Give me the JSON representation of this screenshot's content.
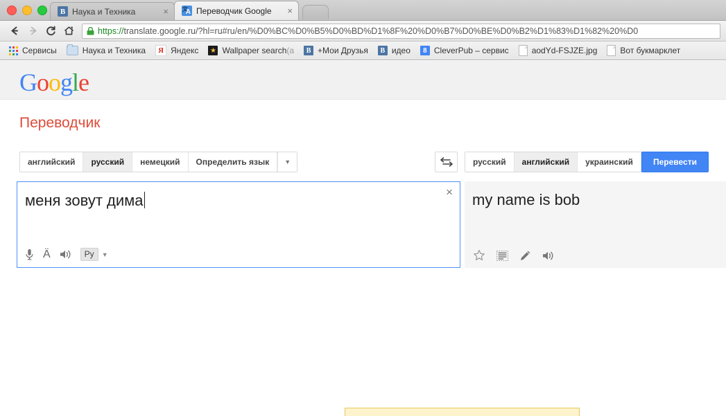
{
  "window": {
    "traffic_lights": [
      "close",
      "minimize",
      "maximize"
    ],
    "tabs": [
      {
        "title": "Наука и Техника",
        "favicon": "vk-icon",
        "active": false,
        "close_label": "×"
      },
      {
        "title": "Переводчик Google",
        "favicon": "google-translate-icon",
        "active": true,
        "close_label": "×"
      }
    ]
  },
  "toolbar": {
    "back_label": "←",
    "forward_label": "→",
    "reload_label": "C",
    "home_label": "⌂",
    "url_scheme": "https://",
    "url_rest": "translate.google.ru/?hl=ru#ru/en/%D0%BC%D0%B5%D0%BD%D1%8F%20%D0%B7%D0%BE%D0%B2%D1%83%D1%82%20%D0",
    "lock_icon": "lock-icon"
  },
  "bookmarks": [
    {
      "label": "Сервисы",
      "icon": "apps-grid-icon",
      "dim": ""
    },
    {
      "label": "Наука и Техника",
      "icon": "folder-icon",
      "dim": ""
    },
    {
      "label": "Яндекс",
      "icon": "yandex-icon",
      "dim": ""
    },
    {
      "label": "Wallpaper search ",
      "icon": "star-black-icon",
      "dim": "(a"
    },
    {
      "label": "+Мои Друзья",
      "icon": "vk-icon",
      "dim": ""
    },
    {
      "label": "идео",
      "icon": "vk-icon",
      "dim": ""
    },
    {
      "label": "CleverPub – сервис",
      "icon": "google-blue-icon",
      "dim": ""
    },
    {
      "label": "aodYd-FSJZE.jpg",
      "icon": "document-icon",
      "dim": ""
    },
    {
      "label": "Вот букмарклет",
      "icon": "document-icon",
      "dim": ""
    }
  ],
  "page": {
    "logo": [
      {
        "ch": "G",
        "color": "blue"
      },
      {
        "ch": "o",
        "color": "red"
      },
      {
        "ch": "o",
        "color": "yellow"
      },
      {
        "ch": "g",
        "color": "blue"
      },
      {
        "ch": "l",
        "color": "green"
      },
      {
        "ch": "e",
        "color": "red"
      }
    ],
    "title": "Переводчик",
    "title_color": "#dd4b39"
  },
  "translate": {
    "source_languages": [
      {
        "label": "английский",
        "active": false
      },
      {
        "label": "русский",
        "active": true
      },
      {
        "label": "немецкий",
        "active": false
      },
      {
        "label": "Определить язык",
        "active": false
      }
    ],
    "source_more_caret": "▼",
    "swap_icon": "swap-arrows-icon",
    "target_languages": [
      {
        "label": "русский",
        "active": false
      },
      {
        "label": "английский",
        "active": true
      },
      {
        "label": "украинский",
        "active": false
      }
    ],
    "target_more_caret": "▼",
    "translate_button": "Перевести",
    "source_text": "меня зовут дима",
    "clear_label": "×",
    "source_tools": [
      {
        "icon": "microphone-icon",
        "label": ""
      },
      {
        "icon": "diacritics-icon",
        "label": "Ä"
      },
      {
        "icon": "speaker-icon",
        "label": ""
      },
      {
        "icon": "keyboard-language-icon",
        "label": "Ру"
      }
    ],
    "keyboard_caret": "▼",
    "result_text": "my name is bob",
    "result_tools": [
      {
        "icon": "star-outline-icon"
      },
      {
        "icon": "text-lines-icon"
      },
      {
        "icon": "pencil-icon"
      },
      {
        "icon": "speaker-icon"
      }
    ],
    "accent_color": "#4285f4",
    "focus_border_color": "#4d90fe",
    "result_bg": "#f5f5f5"
  },
  "notice": {
    "visible": true,
    "bg": "#fdf3cd",
    "border": "#e6c95c"
  }
}
